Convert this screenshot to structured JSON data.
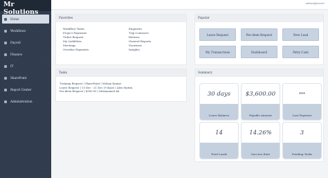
{
  "app": {
    "title": "Mr Solutions"
  },
  "topbar": {
    "user_email": "mdsan@mr.net"
  },
  "sidebar": {
    "items": [
      {
        "label": "Home",
        "icon": "home-icon",
        "active": true
      },
      {
        "label": "Workflows",
        "icon": "workflow-icon"
      },
      {
        "label": "Payroll",
        "icon": "payroll-icon"
      },
      {
        "label": "Finance",
        "icon": "finance-icon"
      },
      {
        "label": "IT",
        "icon": "it-icon"
      },
      {
        "label": "SharePoint",
        "icon": "sharepoint-icon"
      },
      {
        "label": "Report Center",
        "icon": "report-icon"
      },
      {
        "label": "Administration",
        "icon": "admin-icon"
      }
    ]
  },
  "favorites": {
    "title": "Favorites",
    "items": [
      "Workflow Tasks",
      "Enquiries",
      "Project Payments",
      "Trip Contracts",
      "Ticket Request",
      "Returns",
      "My Liabilities",
      "General Reports",
      "Meetings",
      "Vacations",
      "Overdue Payments",
      "Insights"
    ]
  },
  "tasks": {
    "title": "Tasks",
    "items": [
      "Training Request  |  SharePoint  |  Mohan Kumar",
      "Leave Request  |  13 Dec - 21 Dec (9 days)  |  Alex Matrin",
      "Per-diem Request  |  $300.00  |  Mohammed Ali"
    ]
  },
  "popular": {
    "title": "Popular",
    "buttons": [
      "Leave Request",
      "Per-diem Request",
      "New Lead",
      "My Transactions",
      "Dashboard",
      "Petty Cash"
    ]
  },
  "summary": {
    "title": "Summary",
    "cards": [
      {
        "value": "30 days",
        "label": "Leave Balance"
      },
      {
        "value": "$3,600.00",
        "label": "Payable Amount"
      },
      {
        "value": "***",
        "label": "Last Payment"
      },
      {
        "value": "14",
        "label": "Total Leads"
      },
      {
        "value": "14.26%",
        "label": "Success Rate"
      },
      {
        "value": "3",
        "label": "Pending Tasks"
      }
    ]
  }
}
